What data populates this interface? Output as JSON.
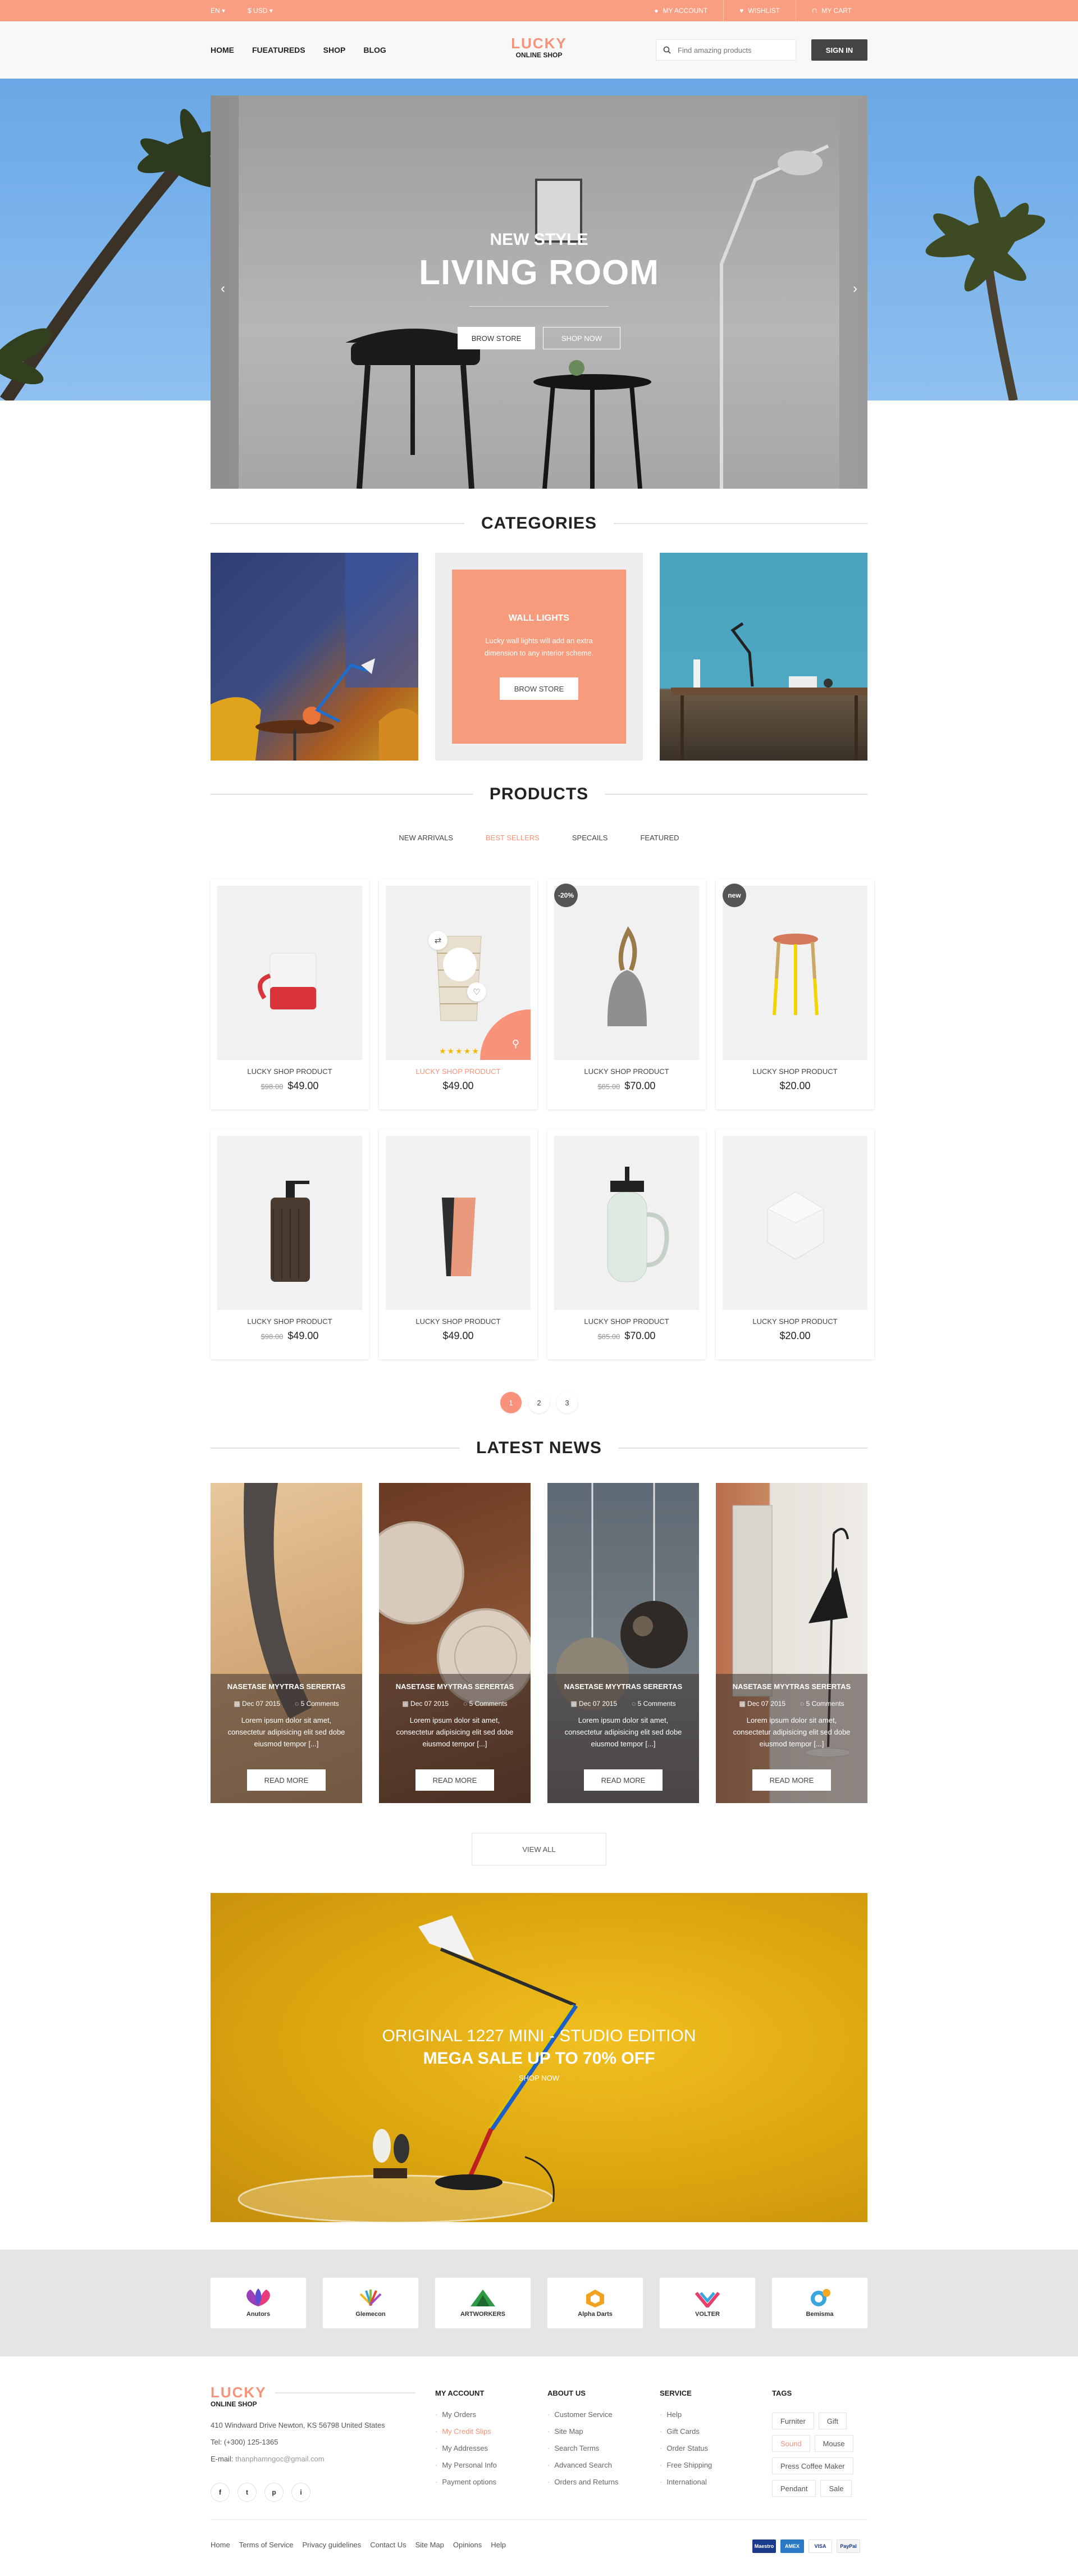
{
  "topbar": {
    "language": "EN",
    "currency": "$ USD",
    "my_account": "MY ACCOUNT",
    "wishlist": "WISHLIST",
    "my_cart": "MY CART"
  },
  "header": {
    "nav": [
      "HOME",
      "FUEATUREDS",
      "SHOP",
      "BLOG"
    ],
    "logo_line1": "LUCKY",
    "logo_line2": "ONLINE SHOP",
    "search_placeholder": "Find amazing products",
    "sign_in": "SIGN IN"
  },
  "hero": {
    "subtitle": "NEW STYLE",
    "title": "LIVING ROOM",
    "button_store": "BROW STORE",
    "button_shop": "SHOP NOW"
  },
  "categories": {
    "title": "CATEGORIES",
    "featured": {
      "title": "WALL LIGHTS",
      "description": "Lucky wall lights will add an extra dimension to any interior scheme.",
      "button": "BROW STORE"
    }
  },
  "products": {
    "title": "PRODUCTS",
    "tabs": [
      "NEW ARRIVALS",
      "BEST SELLERS",
      "SPECAILS",
      "FEATURED"
    ],
    "active_tab": "BEST SELLERS",
    "items": [
      {
        "name": "LUCKY SHOP PRODUCT",
        "old_price": "$98.00",
        "price": "$49.00",
        "badge": ""
      },
      {
        "name": "LUCKY SHOP PRODUCT",
        "old_price": "",
        "price": "$49.00",
        "badge": ""
      },
      {
        "name": "LUCKY SHOP PRODUCT",
        "old_price": "$85.00",
        "price": "$70.00",
        "badge": "-20%"
      },
      {
        "name": "LUCKY SHOP PRODUCT",
        "old_price": "",
        "price": "$20.00",
        "badge": "new"
      },
      {
        "name": "LUCKY SHOP PRODUCT",
        "old_price": "$98.00",
        "price": "$49.00",
        "badge": ""
      },
      {
        "name": "LUCKY SHOP PRODUCT",
        "old_price": "",
        "price": "$49.00",
        "badge": ""
      },
      {
        "name": "LUCKY SHOP PRODUCT",
        "old_price": "$85.00",
        "price": "$70.00",
        "badge": ""
      },
      {
        "name": "LUCKY SHOP PRODUCT",
        "old_price": "",
        "price": "$20.00",
        "badge": ""
      }
    ],
    "rating_stars": "★★★★★",
    "pages": [
      "1",
      "2",
      "3"
    ]
  },
  "news": {
    "title": "LATEST NEWS",
    "items": [
      {
        "title": "NASETASE MYYTRAS SERERTAS",
        "date": "Dec 07 2015",
        "comments": "5 Comments",
        "text": "Lorem ipsum dolor sit amet, consectetur adipisicing elit sed dobe eiusmod tempor [...]",
        "button": "READ MORE"
      },
      {
        "title": "NASETASE MYYTRAS SERERTAS",
        "date": "Dec 07 2015",
        "comments": "5 Comments",
        "text": "Lorem ipsum dolor sit amet, consectetur adipisicing elit sed dobe eiusmod tempor [...]",
        "button": "READ MORE"
      },
      {
        "title": "NASETASE MYYTRAS SERERTAS",
        "date": "Dec 07 2015",
        "comments": "5 Comments",
        "text": "Lorem ipsum dolor sit amet, consectetur adipisicing elit sed dobe eiusmod tempor [...]",
        "button": "READ MORE"
      },
      {
        "title": "NASETASE MYYTRAS SERERTAS",
        "date": "Dec 07 2015",
        "comments": "5 Comments",
        "text": "Lorem ipsum dolor sit amet, consectetur adipisicing elit sed dobe eiusmod tempor [...]",
        "button": "READ MORE"
      }
    ],
    "view_all": "VIEW ALL"
  },
  "banner": {
    "line1": "ORIGINAL 1227 MINI - STUDIO EDITION",
    "line2": "MEGA SALE UP TO 70% OFF",
    "cta": "SHOP NOW"
  },
  "brands": [
    "Anutors",
    "Glemecon",
    "ARTWORKERS",
    "Alpha Darts",
    "VOLTER",
    "Bemisma"
  ],
  "footer": {
    "logo_line1": "LUCKY",
    "logo_line2": "ONLINE SHOP",
    "address": "410 Windward Drive Newton, KS 56798 United States",
    "tel": "Tel: (+300) 125-1365",
    "email_label": "E-mail:",
    "email": "thanphamngoc@gmail.com",
    "socials": [
      "f",
      "t",
      "p",
      "i"
    ],
    "my_account": {
      "title": "MY ACCOUNT",
      "items": [
        "My Orders",
        "My Credit Slips",
        "My Addresses",
        "My Personal Info",
        "Payment options"
      ]
    },
    "about_us": {
      "title": "ABOUT US",
      "items": [
        "Customer Service",
        "Site Map",
        "Search Terms",
        "Advanced Search",
        "Orders and Returns"
      ]
    },
    "service": {
      "title": "SERVICE",
      "items": [
        "Help",
        "Gift Cards",
        "Order Status",
        "Free Shipping",
        "International"
      ]
    },
    "tags_title": "TAGS",
    "tags": [
      "Furniter",
      "Gift",
      "Sound",
      "Mouse",
      "Press Coffee Maker",
      "Pendant",
      "Sale"
    ],
    "links": [
      "Home",
      "Terms of Service",
      "Privacy guidelines",
      "Contact Us",
      "Site Map",
      "Opinions",
      "Help"
    ],
    "payments": [
      "Maestro",
      "AMEX",
      "VISA",
      "PayPal"
    ]
  },
  "colors": {
    "accent": "#f8927a",
    "topbar": "#f99e80",
    "dark": "#444444"
  }
}
